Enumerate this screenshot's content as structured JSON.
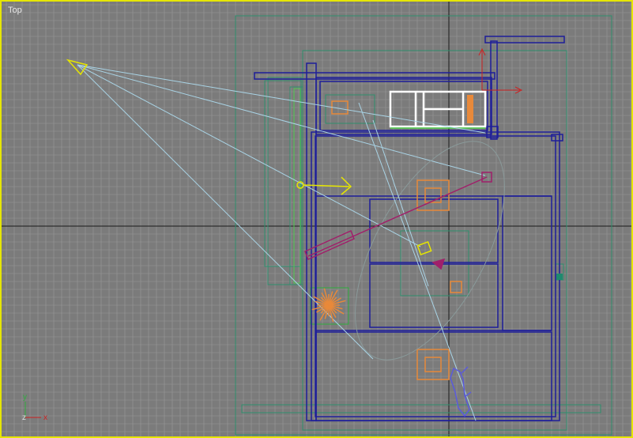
{
  "viewport": {
    "label": "Top",
    "active_border_color": "#e6e600",
    "background_color": "#7b7b7b",
    "grid_color": "#9a9a9a",
    "axis_line_color": "#1a1a1a"
  },
  "gizmo": {
    "y_label": "y",
    "x_label": "x",
    "z_label": "z"
  },
  "scene_colors": {
    "walls": "#1e1e9a",
    "helpers": "#2f8f6e",
    "boxes": "#e8893a",
    "selected": "#ffffff",
    "camera_lines": "#a9d4e6",
    "light": "#e6e600",
    "spot_target": "#a0206a",
    "plant": "#e8893a",
    "figure": "#5a5adc"
  }
}
